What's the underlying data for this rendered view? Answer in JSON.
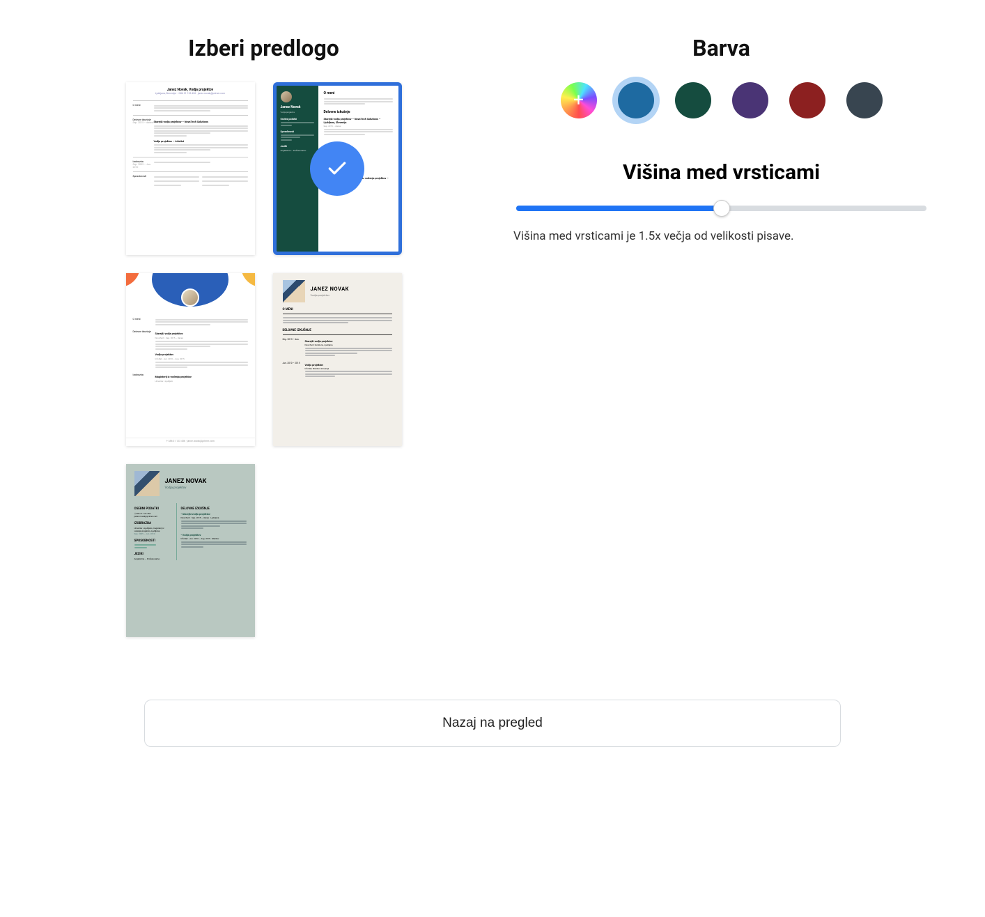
{
  "templates": {
    "heading": "Izberi predlogo",
    "selected_index": 1,
    "cards": [
      {
        "name": "Janez Novak, Vodja projektov"
      },
      {
        "name": "Janez Novak",
        "section_about": "O meni",
        "section_exp": "Delovne izkušnje",
        "sidebar_contact": "Osebni podatki",
        "sidebar_skills": "Sposobnosti",
        "sidebar_lang": "Jeziki"
      },
      {
        "section_about": "O meni",
        "section_exp": "Delovne izkušnje",
        "section_edu": "Izobrazba"
      },
      {
        "name": "JANEZ NOVAK",
        "role": "Vodja projektov",
        "section_about": "O MENI",
        "section_exp": "DELOVNE IZKUŠNJE"
      },
      {
        "name": "JANEZ NOVAK",
        "role": "Vodja projektov",
        "section_personal": "OSEBNI PODATKI",
        "section_edu": "IZOBRAZBA",
        "section_skills": "SPOSOBNOSTI",
        "section_lang": "JEZIKI",
        "section_exp": "DELOVNE IZKUŠNJE"
      }
    ]
  },
  "colors": {
    "heading": "Barva",
    "selected_index": 1,
    "swatches": [
      {
        "id": "custom",
        "type": "rainbow"
      },
      {
        "id": "blue",
        "hex": "#1e6aa1"
      },
      {
        "id": "green",
        "hex": "#154c3f"
      },
      {
        "id": "purple",
        "hex": "#4a3475"
      },
      {
        "id": "red",
        "hex": "#8c2020"
      },
      {
        "id": "slate",
        "hex": "#384550"
      }
    ]
  },
  "slider": {
    "heading": "Višina med vrsticami",
    "value_percent": 50,
    "caption": "Višina med vrsticami je 1.5x večja od velikosti pisave."
  },
  "back_button": "Nazaj na pregled"
}
